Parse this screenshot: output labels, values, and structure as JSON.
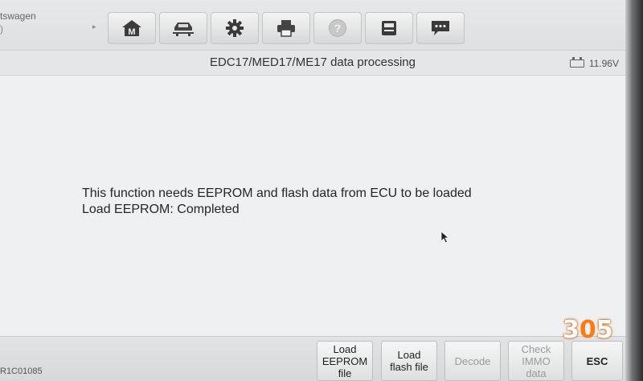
{
  "header": {
    "vehicle_line1": "tswagen",
    "vehicle_line2": ")",
    "toolbar": [
      {
        "name": "home-button",
        "icon": "home-m-icon"
      },
      {
        "name": "vehicle-swap-button",
        "icon": "car-lift-icon"
      },
      {
        "name": "settings-button",
        "icon": "gear-icon"
      },
      {
        "name": "print-button",
        "icon": "printer-icon"
      },
      {
        "name": "help-button",
        "icon": "help-icon"
      },
      {
        "name": "save-button",
        "icon": "save-icon"
      },
      {
        "name": "message-button",
        "icon": "chat-icon"
      }
    ]
  },
  "titlebar": {
    "title": "EDC17/MED17/ME17 data processing",
    "battery_voltage": "11.96V"
  },
  "main": {
    "message_line1": "This function needs EEPROM and flash data from ECU to be loaded",
    "message_line2": "Load EEPROM: Completed"
  },
  "footer": {
    "serial": "R1C01085",
    "buttons": {
      "load_eeprom_l1": "Load",
      "load_eeprom_l2": "EEPROM",
      "load_eeprom_l3": "file",
      "load_flash_l1": "Load",
      "load_flash_l2": "flash file",
      "decode": "Decode",
      "check_immo_l1": "Check",
      "check_immo_l2": "IMMO",
      "check_immo_l3": "data",
      "esc": "ESC"
    }
  },
  "watermark": {
    "d1": "3",
    "d2": "0",
    "d3": "5"
  },
  "colors": {
    "badge_orange": "#ff7a12",
    "screen_bg": "#eef0f1"
  }
}
